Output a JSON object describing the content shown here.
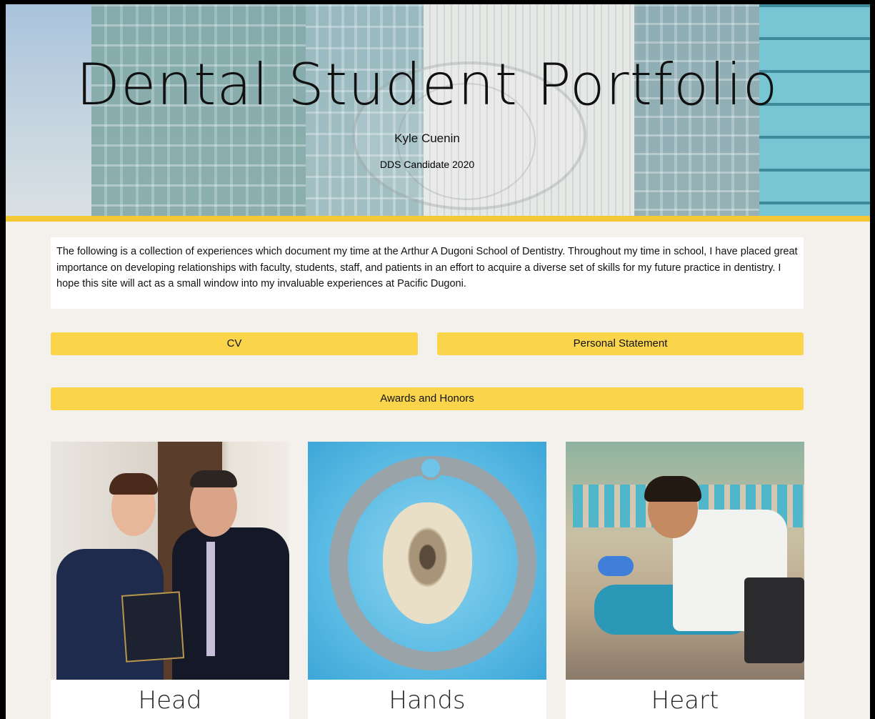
{
  "hero": {
    "title": "Dental Student Portfolio",
    "name": "Kyle Cuenin",
    "subtitle": "DDS Candidate 2020"
  },
  "intro": {
    "text": "The following is a collection of experiences which document my time at the Arthur A Dugoni School of Dentistry. Throughout my time in school, I have placed great importance on developing relationships with faculty, students, staff, and patients in an effort to acquire a diverse set of skills for my future practice in dentistry. I hope this site will act as a small window into my invaluable experiences at Pacific Dugoni."
  },
  "buttons": {
    "cv": "CV",
    "personal_statement": "Personal Statement",
    "awards": "Awards and Honors"
  },
  "cards": [
    {
      "label": "Head",
      "image": "graduation-photo"
    },
    {
      "label": "Hands",
      "image": "tooth-photo"
    },
    {
      "label": "Heart",
      "image": "dental-outreach-photo"
    }
  ],
  "colors": {
    "accent": "#fad54b",
    "accent_bar": "#f5c936",
    "background": "#f4f1ec"
  }
}
